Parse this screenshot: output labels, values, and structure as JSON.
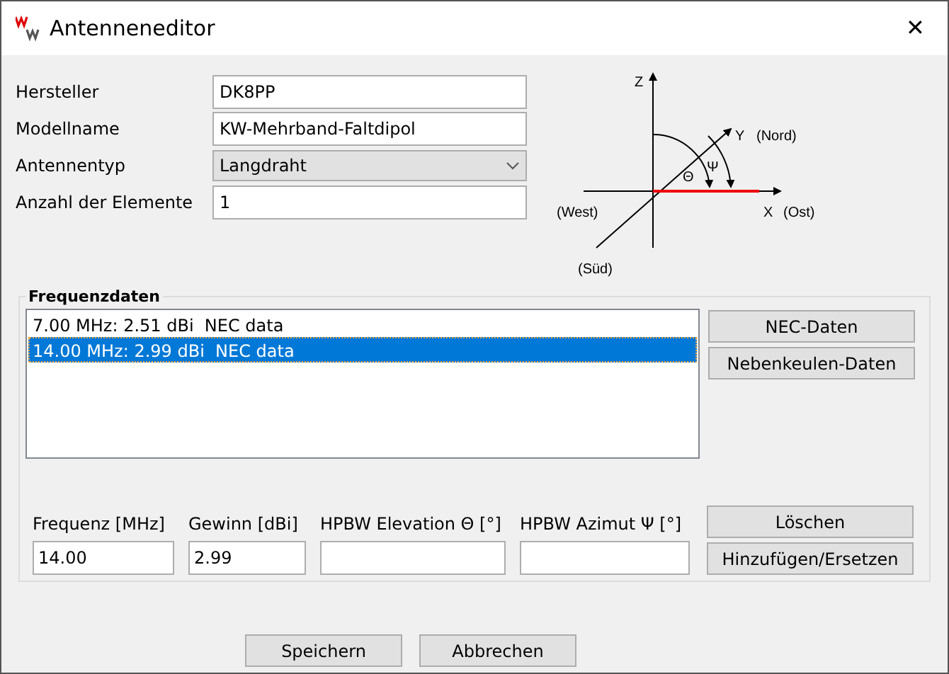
{
  "window": {
    "title": "Antenneneditor",
    "close": "✕"
  },
  "fields": [
    {
      "kind": "text",
      "label": "Hersteller",
      "value": "DK8PP"
    },
    {
      "kind": "text",
      "label": "Modellname",
      "value": "KW-Mehrband-Faltdipol"
    },
    {
      "kind": "select",
      "label": "Antennentyp",
      "value": "Langdraht"
    },
    {
      "kind": "text",
      "label": "Anzahl der Elemente",
      "value": "1"
    }
  ],
  "diagram": {
    "z": "Z",
    "y": "Y",
    "north": "(Nord)",
    "west": "(West)",
    "x": "X",
    "east": "(Ost)",
    "south": "(Süd)",
    "theta": "Θ",
    "psi": "Ψ"
  },
  "frequency_data": {
    "title": "Frequenzdaten",
    "items": [
      {
        "label": "7.00 MHz: 2.51 dBi  NEC data",
        "selected": false
      },
      {
        "label": "14.00 MHz: 2.99 dBi  NEC data",
        "selected": true
      }
    ],
    "side_buttons": [
      "NEC-Daten",
      "Nebenkeulen-Daten"
    ],
    "inputs": [
      {
        "label": "Frequenz [MHz]",
        "value": "14.00"
      },
      {
        "label": "Gewinn [dBi]",
        "value": "2.99"
      },
      {
        "label": "HPBW Elevation Θ [°]"
      },
      {
        "label": "HPBW Azimut Ψ [°]"
      }
    ],
    "edit_buttons": [
      "Löschen",
      "Hinzufügen/Ersetzen"
    ]
  },
  "buttons": [
    "Speichern",
    "Abbrechen"
  ]
}
